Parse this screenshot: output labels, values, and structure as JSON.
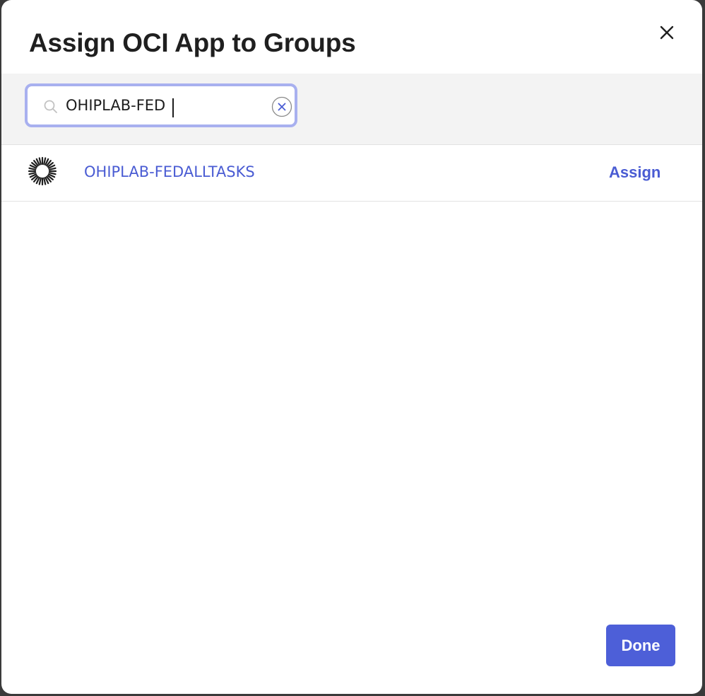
{
  "dialog": {
    "title": "Assign OCI App to Groups",
    "close_icon": "close-icon"
  },
  "search": {
    "value": "OHIPLAB-FED",
    "icon": "search-icon",
    "clear_icon": "clear-circle-x-icon"
  },
  "results": [
    {
      "icon": "group-sunburst-icon",
      "name": "OHIPLAB-FEDALLTASKS",
      "action_label": "Assign"
    }
  ],
  "footer": {
    "done_label": "Done"
  },
  "colors": {
    "accent": "#4d5fd8",
    "link": "#4a5cd3",
    "focus_ring": "#a8b0ef",
    "search_area_bg": "#f3f3f3"
  }
}
